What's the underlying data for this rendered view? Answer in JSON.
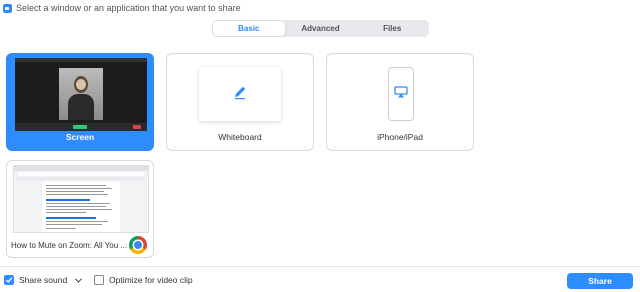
{
  "window": {
    "title": "Select a window or an application that you want to share"
  },
  "tabs": [
    {
      "label": "Basic",
      "active": true
    },
    {
      "label": "Advanced",
      "active": false
    },
    {
      "label": "Files",
      "active": false
    }
  ],
  "sources": {
    "screen": {
      "label": "Screen",
      "selected": true
    },
    "whiteboard": {
      "label": "Whiteboard",
      "selected": false
    },
    "iphone": {
      "label": "iPhone/iPad",
      "selected": false
    },
    "chrome": {
      "label": "How to Mute on Zoom: All You ...",
      "selected": false
    }
  },
  "footer": {
    "share_sound": {
      "label": "Share sound",
      "checked": true
    },
    "optimize_video": {
      "label": "Optimize for video clip",
      "checked": false
    },
    "share_button": "Share"
  },
  "colors": {
    "accent": "#2d8cff"
  },
  "icons": [
    "zoom-icon",
    "pencil-icon",
    "airplay-icon",
    "chrome-icon",
    "checkmark-icon",
    "chevron-down-icon"
  ]
}
